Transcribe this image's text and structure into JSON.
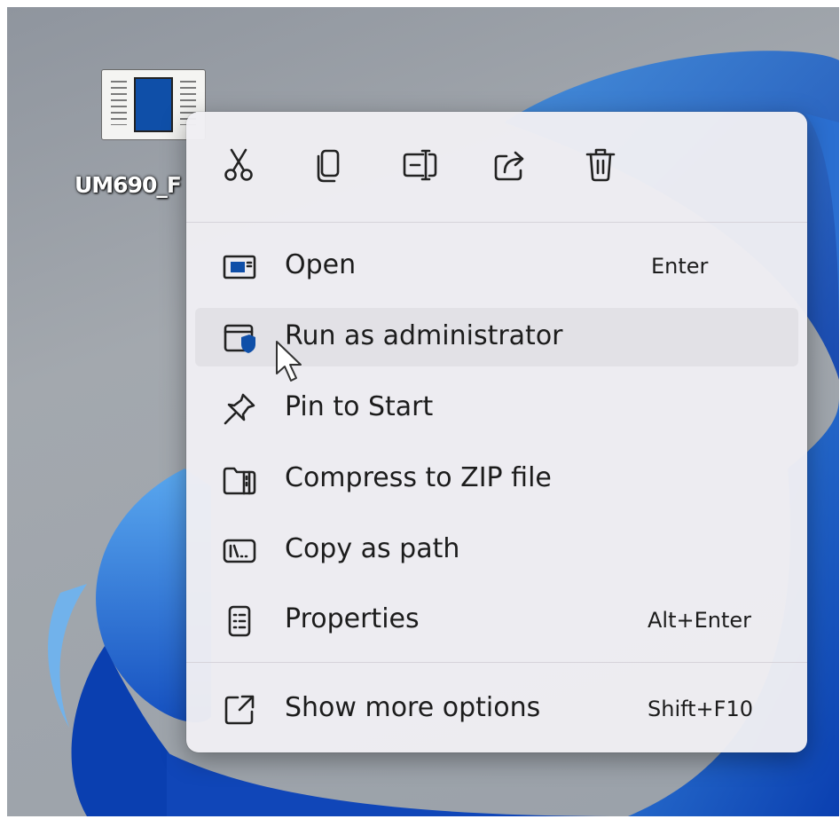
{
  "desktop": {
    "icon_label": "UM690_F"
  },
  "context_menu": {
    "toolbar": [
      {
        "name": "cut-button",
        "icon": "scissors-icon",
        "tooltip": "Cut"
      },
      {
        "name": "copy-button",
        "icon": "copy-icon",
        "tooltip": "Copy"
      },
      {
        "name": "rename-button",
        "icon": "rename-icon",
        "tooltip": "Rename"
      },
      {
        "name": "share-button",
        "icon": "share-icon",
        "tooltip": "Share"
      },
      {
        "name": "delete-button",
        "icon": "trash-icon",
        "tooltip": "Delete"
      }
    ],
    "items": [
      {
        "label": "Open",
        "shortcut": "Enter",
        "icon": "window-icon"
      },
      {
        "label": "Run as administrator",
        "shortcut": "",
        "icon": "admin-shield-icon"
      },
      {
        "label": "Pin to Start",
        "shortcut": "",
        "icon": "pin-icon"
      },
      {
        "label": "Compress to ZIP file",
        "shortcut": "",
        "icon": "zip-folder-icon"
      },
      {
        "label": "Copy as path",
        "shortcut": "",
        "icon": "path-icon"
      },
      {
        "label": "Properties",
        "shortcut": "Alt+Enter",
        "icon": "properties-icon"
      }
    ],
    "footer_item": {
      "label": "Show more options",
      "shortcut": "Shift+F10",
      "icon": "expand-icon"
    },
    "hovered_item": "Run as administrator"
  },
  "colors": {
    "menu_background": "#f0eef3",
    "accent_blue": "#0f4fa8",
    "desktop_gray": "#9aa1a9"
  }
}
